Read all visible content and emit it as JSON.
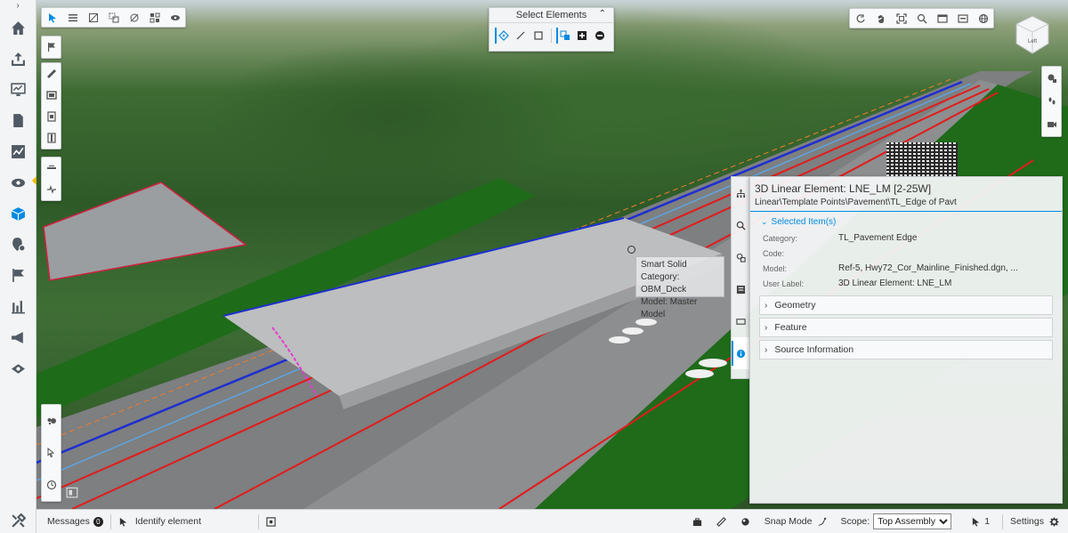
{
  "sidebar": {
    "items": [
      {
        "name": "home-icon"
      },
      {
        "name": "upload-icon"
      },
      {
        "name": "present-icon"
      },
      {
        "name": "document-icon"
      },
      {
        "name": "chart-line-icon"
      },
      {
        "name": "eye-icon"
      },
      {
        "name": "cube-icon"
      },
      {
        "name": "issue-icon"
      },
      {
        "name": "flag-icon"
      },
      {
        "name": "bar-chart-icon"
      },
      {
        "name": "megaphone-icon"
      },
      {
        "name": "view-icon"
      }
    ]
  },
  "select_panel": {
    "title": "Select Elements"
  },
  "info_panel": {
    "title": "3D Linear Element: LNE_LM [2-25W]",
    "path": "Linear\\Template Points\\Pavement\\TL_Edge of Pavt",
    "section_label": "Selected Item(s)",
    "properties": [
      {
        "key": "Category:",
        "value": "TL_Pavement Edge"
      },
      {
        "key": "Code:",
        "value": ""
      },
      {
        "key": "Model:",
        "value": "Ref-5, Hwy72_Cor_Mainline_Finished.dgn, ..."
      },
      {
        "key": "User Label:",
        "value": "3D Linear Element: LNE_LM"
      }
    ],
    "groups": [
      "Geometry",
      "Feature",
      "Source Information"
    ]
  },
  "tooltip": {
    "lines": [
      "Smart Solid",
      "Category: OBM_Deck",
      "Model: Master Model"
    ]
  },
  "view_cube": {
    "face_label": "Left"
  },
  "statusbar": {
    "messages_label": "Messages",
    "messages_count": "0",
    "identify_label": "Identify element",
    "snap_label": "Snap Mode",
    "scope_label": "Scope:",
    "scope_value": "Top Assembly",
    "scope_options": [
      "Top Assembly"
    ],
    "selection_count": "1",
    "settings_label": "Settings"
  },
  "colors": {
    "accent": "#008be1",
    "marker": "#f2b800"
  }
}
